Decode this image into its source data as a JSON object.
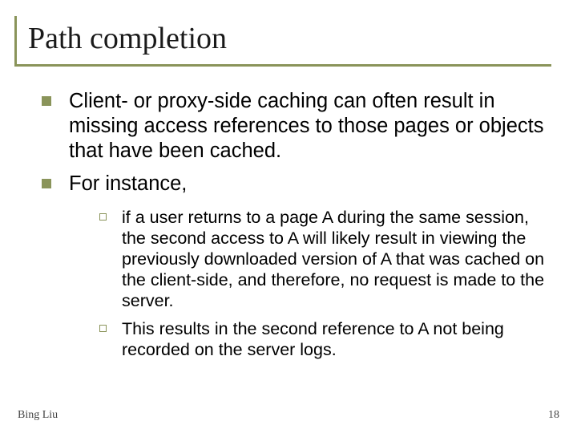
{
  "title": "Path completion",
  "bullets": {
    "b1": "Client- or proxy-side caching can often result in missing access references to those pages or objects that have been cached.",
    "b2": "For instance,",
    "sub": {
      "s1": "if a user returns to a page A during the same session, the second access to A will likely result in viewing the previously downloaded version of A that was cached on the client-side, and therefore, no request is made to the server.",
      "s2": "This results in the second reference to A not being recorded on the server logs."
    }
  },
  "footer": {
    "author": "Bing Liu",
    "page": "18"
  }
}
